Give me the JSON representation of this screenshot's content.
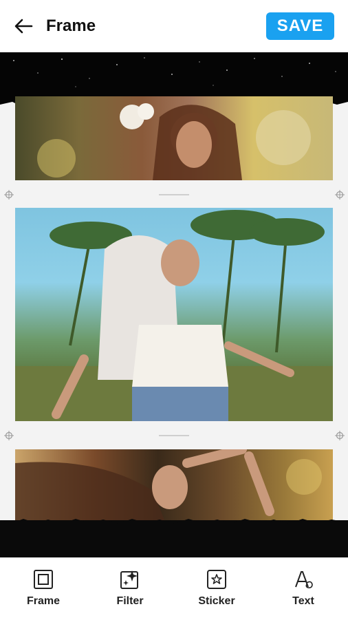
{
  "header": {
    "title": "Frame",
    "save_label": "SAVE",
    "back_icon": "arrow-left-icon",
    "accent": "#1aa1f0"
  },
  "canvas": {
    "frame_colors": {
      "torn_paper": "#050505",
      "frame_bg": "#f3f3f3"
    },
    "photos": [
      {
        "name": "photo-top",
        "subject": "woman with flower in hair"
      },
      {
        "name": "photo-middle",
        "subject": "woman dancing at festival"
      },
      {
        "name": "photo-bottom",
        "subject": "woman with hair flying"
      }
    ]
  },
  "toolbar": {
    "items": [
      {
        "label": "Frame",
        "icon": "frame-icon"
      },
      {
        "label": "Filter",
        "icon": "filter-icon"
      },
      {
        "label": "Sticker",
        "icon": "sticker-icon"
      },
      {
        "label": "Text",
        "icon": "text-icon"
      }
    ]
  }
}
